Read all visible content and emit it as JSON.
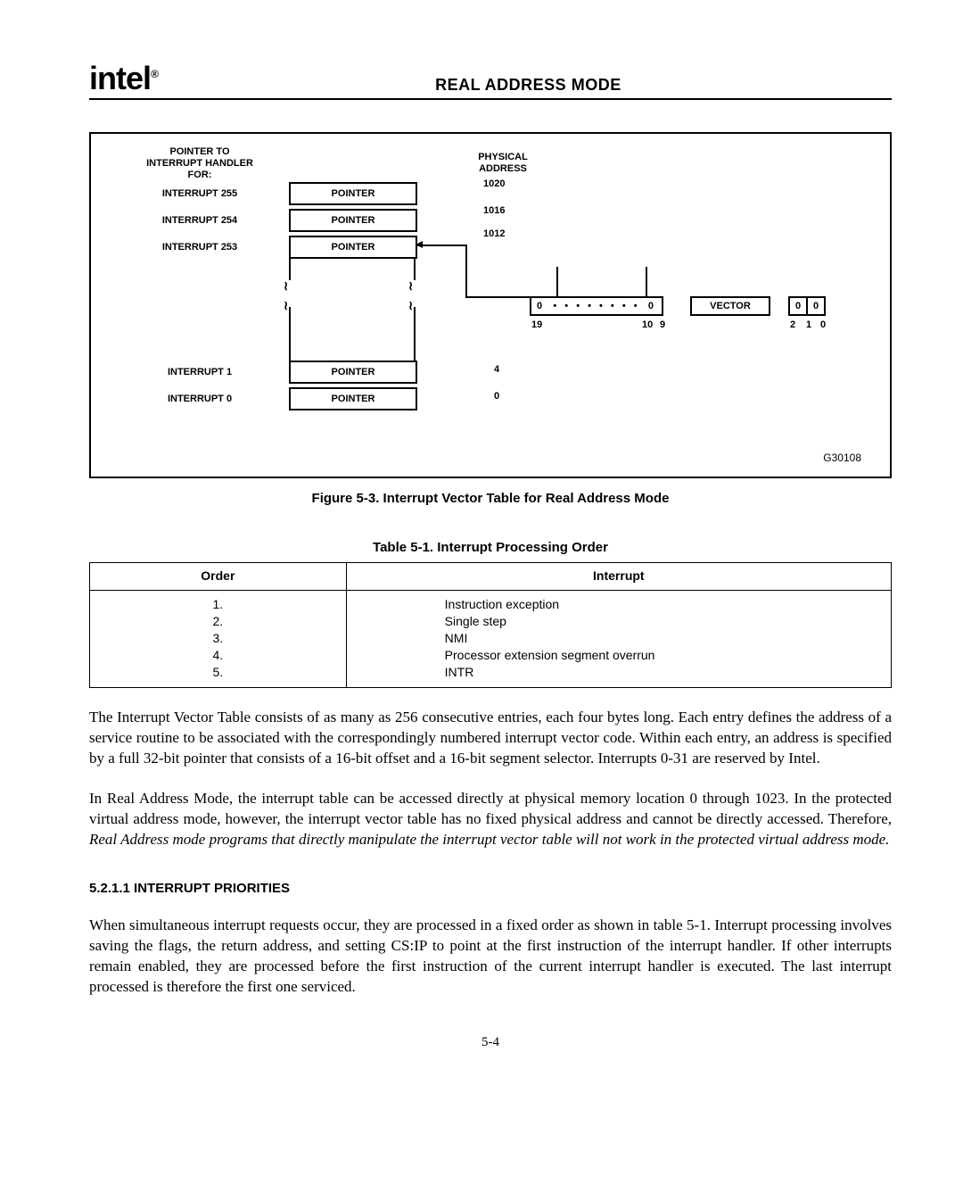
{
  "header": {
    "logo": "intel",
    "title": "REAL ADDRESS MODE"
  },
  "figure": {
    "pointer_to_label": "POINTER TO\nINTERRUPT HANDLER\nFOR:",
    "physical_address_label": "PHYSICAL\nADDRESS",
    "rows": [
      {
        "label": "INTERRUPT 255",
        "box": "POINTER",
        "addr": "1020"
      },
      {
        "label": "INTERRUPT 254",
        "box": "POINTER",
        "addr": "1016"
      },
      {
        "label": "INTERRUPT 253",
        "box": "POINTER",
        "addr": "1012"
      }
    ],
    "rows_bottom": [
      {
        "label": "INTERRUPT 1",
        "box": "POINTER",
        "addr": "4"
      },
      {
        "label": "INTERRUPT 0",
        "box": "POINTER",
        "addr": "0"
      }
    ],
    "vector": {
      "dots_left": "0",
      "dots_right": "0",
      "vector_label": "VECTOR",
      "small_left": "0",
      "small_right": "0",
      "bit_19": "19",
      "bit_10": "10",
      "bit_9": "9",
      "bit_2": "2",
      "bit_1": "1",
      "bit_0": "0"
    },
    "code": "G30108",
    "caption": "Figure 5-3.  Interrupt Vector Table for Real Address Mode"
  },
  "table": {
    "caption": "Table 5-1.  Interrupt Processing Order",
    "head_order": "Order",
    "head_interrupt": "Interrupt",
    "rows": [
      {
        "order": "1.",
        "interrupt": "Instruction exception"
      },
      {
        "order": "2.",
        "interrupt": "Single step"
      },
      {
        "order": "3.",
        "interrupt": "NMI"
      },
      {
        "order": "4.",
        "interrupt": "Processor extension segment overrun"
      },
      {
        "order": "5.",
        "interrupt": "INTR"
      }
    ]
  },
  "paragraphs": {
    "p1": "The Interrupt Vector Table consists of as many as 256 consecutive entries, each four bytes long. Each entry defines the address of a service routine to be associated with the correspondingly numbered interrupt vector code. Within each entry, an address is specified by a full 32-bit pointer that consists of a 16-bit offset and a 16-bit segment selector. Interrupts 0-31 are reserved by Intel.",
    "p2a": "In Real Address Mode, the interrupt table can be accessed directly at physical memory location 0 through 1023. In the protected virtual address mode, however, the interrupt vector table has no fixed physical address and cannot be directly accessed. Therefore, ",
    "p2b_italic": "Real Address mode programs that directly manipulate the interrupt vector table will not work in the protected virtual address mode.",
    "section_head": "5.2.1.1  INTERRUPT PRIORITIES",
    "p3": "When simultaneous interrupt requests occur, they are processed in a fixed order as shown in table 5-1. Interrupt processing involves saving the flags, the return address, and setting CS:IP to point at the first instruction of the interrupt handler. If other interrupts remain enabled, they are processed before the first instruction of the current interrupt handler is executed. The last interrupt processed is therefore the first one serviced."
  },
  "pagenum": "5-4"
}
